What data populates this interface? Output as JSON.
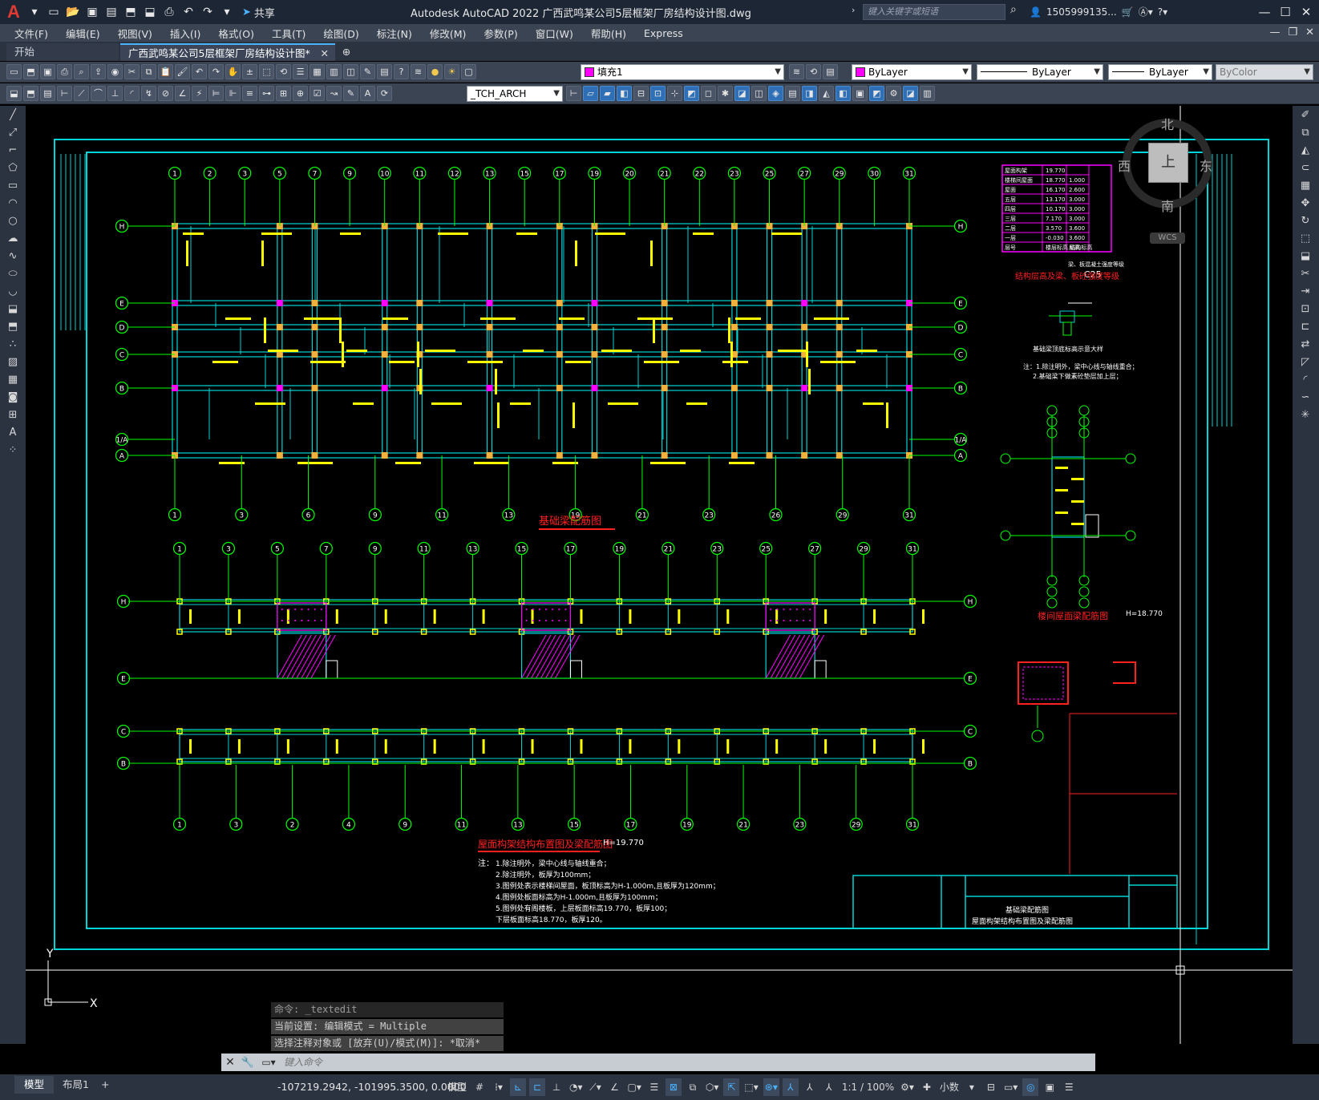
{
  "app": {
    "title": "Autodesk AutoCAD 2022    广西武鸣某公司5层框架厂房结构设计图.dwg",
    "logo": "A",
    "share_label": "共享",
    "search_placeholder": "键入关键字或短语",
    "user_name": "1505999135...",
    "quick_access_icons": [
      "new-icon",
      "open-icon",
      "save-icon",
      "saveas-icon",
      "web-open-icon",
      "web-save-icon",
      "plot-icon",
      "undo-icon",
      "redo-icon",
      "dropdown-icon"
    ]
  },
  "menu": {
    "items": [
      "文件(F)",
      "编辑(E)",
      "视图(V)",
      "插入(I)",
      "格式(O)",
      "工具(T)",
      "绘图(D)",
      "标注(N)",
      "修改(M)",
      "参数(P)",
      "窗口(W)",
      "帮助(H)",
      "Express"
    ]
  },
  "tabs": {
    "start": "开始",
    "drawing": "广西武鸣某公司5层框架厂房结构设计图*",
    "add": "+"
  },
  "toolbar": {
    "layer_name": "填充1",
    "color": "ByLayer",
    "linetype": "ByLayer",
    "lineweight": "ByLayer",
    "plotstyle": "ByColor",
    "text_style": "_TCH_ARCH"
  },
  "viewcube": {
    "north": "北",
    "south": "南",
    "east": "东",
    "west": "西",
    "top": "上",
    "wcs": "WCS"
  },
  "drawing": {
    "plan_title": "基础梁配筋图",
    "roof_title": "屋面构架结构布置图及梁配筋图",
    "roof_elev": "H=19.770",
    "stair_title": "楼间屋面梁配筋图",
    "stair_elev": "H=18.770",
    "section_title": "基础梁顶底标高示意大样",
    "table_title": "结构层高及梁、板砼强度等级",
    "concrete": "C25",
    "notes_label": "注：",
    "titleblock_name_1": "基础梁配筋图",
    "titleblock_name_2": "屋面构架结构布置图及梁配筋图",
    "plan_top_axes": [
      "1",
      "2",
      "3",
      "5",
      "7",
      "9",
      "10",
      "11",
      "12",
      "13",
      "15",
      "17",
      "19",
      "20",
      "21",
      "22",
      "23",
      "25",
      "27",
      "29",
      "30",
      "31"
    ],
    "plan_bottom_axes": [
      "1",
      "3",
      "6",
      "9",
      "11",
      "13",
      "19",
      "21",
      "23",
      "26",
      "29",
      "31"
    ],
    "plan_rows": [
      "H",
      "E",
      "D",
      "C",
      "B",
      "1/A",
      "A"
    ],
    "roof_axes": [
      "1",
      "3",
      "5",
      "7",
      "9",
      "11",
      "13",
      "15",
      "17",
      "19",
      "21",
      "23",
      "25",
      "27",
      "29",
      "31"
    ],
    "roof_bottom_axes": [
      "1",
      "3",
      "2",
      "4",
      "9",
      "11",
      "13",
      "15",
      "17",
      "19",
      "21",
      "23",
      "29",
      "31"
    ],
    "roof_rows": [
      "H",
      "E",
      "C",
      "B"
    ],
    "notes": [
      "1.除注明外，梁中心线与轴线重合；",
      "2.除注明外，板厚为100mm；",
      "3.图例处表示楼梯间屋面，板顶标高为H-1.000m,且板厚为120mm；",
      "4.图例处板面标高为H-1.000m,且板厚为100mm；",
      "5.图例处有阁楼板，上层板面标高19.770，板厚100；",
      "下层板面标高18.770，板厚120。"
    ],
    "section_notes": [
      "注：1.除注明外，梁中心线与轴线重合；",
      "2.基础梁下做素砼垫层加上层；"
    ],
    "level_table": [
      [
        "屋面构架",
        "19.770",
        ""
      ],
      [
        "楼梯间屋面",
        "18.770",
        "1.000"
      ],
      [
        "屋面",
        "16.170",
        "2.600"
      ],
      [
        "五层",
        "13.170",
        "3.000"
      ],
      [
        "四层",
        "10.170",
        "3.000"
      ],
      [
        "三层",
        "7.170",
        "3.000"
      ],
      [
        "二层",
        "3.570",
        "3.600"
      ],
      [
        "一层",
        "-0.030",
        "3.600"
      ],
      [
        "层号",
        "楼层标高 结构标高",
        "层高"
      ]
    ],
    "table_note": "梁、板混凝土强度等级"
  },
  "command": {
    "history": [
      "命令: _textedit",
      "当前设置: 编辑模式 = Multiple",
      "选择注释对象或 [放弃(U)/模式(M)]: *取消*"
    ],
    "placeholder": "键入命令"
  },
  "status": {
    "model_tab": "模型",
    "layout_tab": "布局1",
    "add_layout": "+",
    "coords": "-107219.2942, -101995.3500, 0.0000",
    "model_label": "模型",
    "scale": "1:1 / 100%",
    "units": "小数"
  },
  "colors": {
    "cyan": "#00d4d4",
    "green": "#00ff00",
    "yellow": "#ffff00",
    "magenta": "#ff00ff",
    "red": "#ff2020"
  }
}
